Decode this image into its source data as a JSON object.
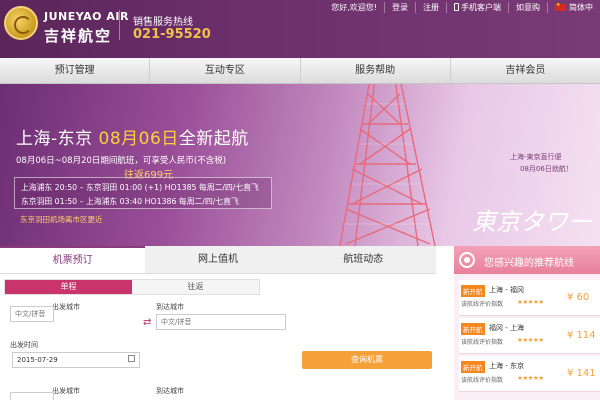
{
  "header": {
    "brand_en": "JUNEYAO AIR",
    "brand_cn": "吉祥航空",
    "hotline_label": "销售服务热线",
    "hotline_number": "021-95520",
    "top_links": [
      "您好,欢迎您!",
      "登录",
      "注册",
      "手机客户端",
      "如意购",
      "简体中"
    ]
  },
  "nav": {
    "items": [
      "预订管理",
      "互动专区",
      "服务帮助",
      "吉祥会员"
    ]
  },
  "banner": {
    "title_route": "上海-东京 ",
    "title_date": "08月06日",
    "title_suffix": "全新起航",
    "sub_prefix": "08月06日~08月20日期间航班，可享受",
    "sub_price": "往返699元",
    "sub_suffix": "人民币(不含税)",
    "schedule": [
      "上海浦东 20:50 – 东京羽田 01:00 (+1)  HO1385  每周二/四/七直飞",
      "东京羽田 01:50 – 上海浦东 03:40        HO1386  每周二/四/七直飞"
    ],
    "note": "东京羽田机场离市区更近",
    "jp_title": "東京タワー",
    "jp_sub1": "上海-東京直行便",
    "jp_sub2": "08月06日就航！"
  },
  "tabs": [
    "机票预订",
    "网上值机",
    "航班动态"
  ],
  "form": {
    "trip_types": [
      "单程",
      "往返"
    ],
    "depart_city_label": "出发城市",
    "arrive_city_label": "到达城市",
    "depart_city_placeholder": "中文/拼音",
    "arrive_city_placeholder": "中文/拼音",
    "depart_time_label": "出发时间",
    "depart_date_value": "2015-07-29",
    "search_button": "查询机票",
    "depart_city_label_2": "出发城市",
    "arrive_city_label_2": "到达城市"
  },
  "recommend": {
    "title": "您感兴趣的推荐航线",
    "items": [
      {
        "badge": "新开航",
        "route": "上海 - 福冈",
        "rating_label": "该航线评价指数",
        "stars": "★★★★★",
        "price": "¥ 60"
      },
      {
        "badge": "新开航",
        "route": "福冈 - 上海",
        "rating_label": "该航线评价指数",
        "stars": "★★★★★",
        "price": "¥ 114"
      },
      {
        "badge": "新开航",
        "route": "上海 - 东京",
        "rating_label": "该航线评价指数",
        "stars": "★★★★★",
        "price": "¥ 141"
      }
    ]
  },
  "colors": {
    "brand_purple": "#6c2f6c",
    "accent_gold": "#f3c14b",
    "search_orange": "#f5a13a",
    "trip_active": "#c9356a"
  }
}
